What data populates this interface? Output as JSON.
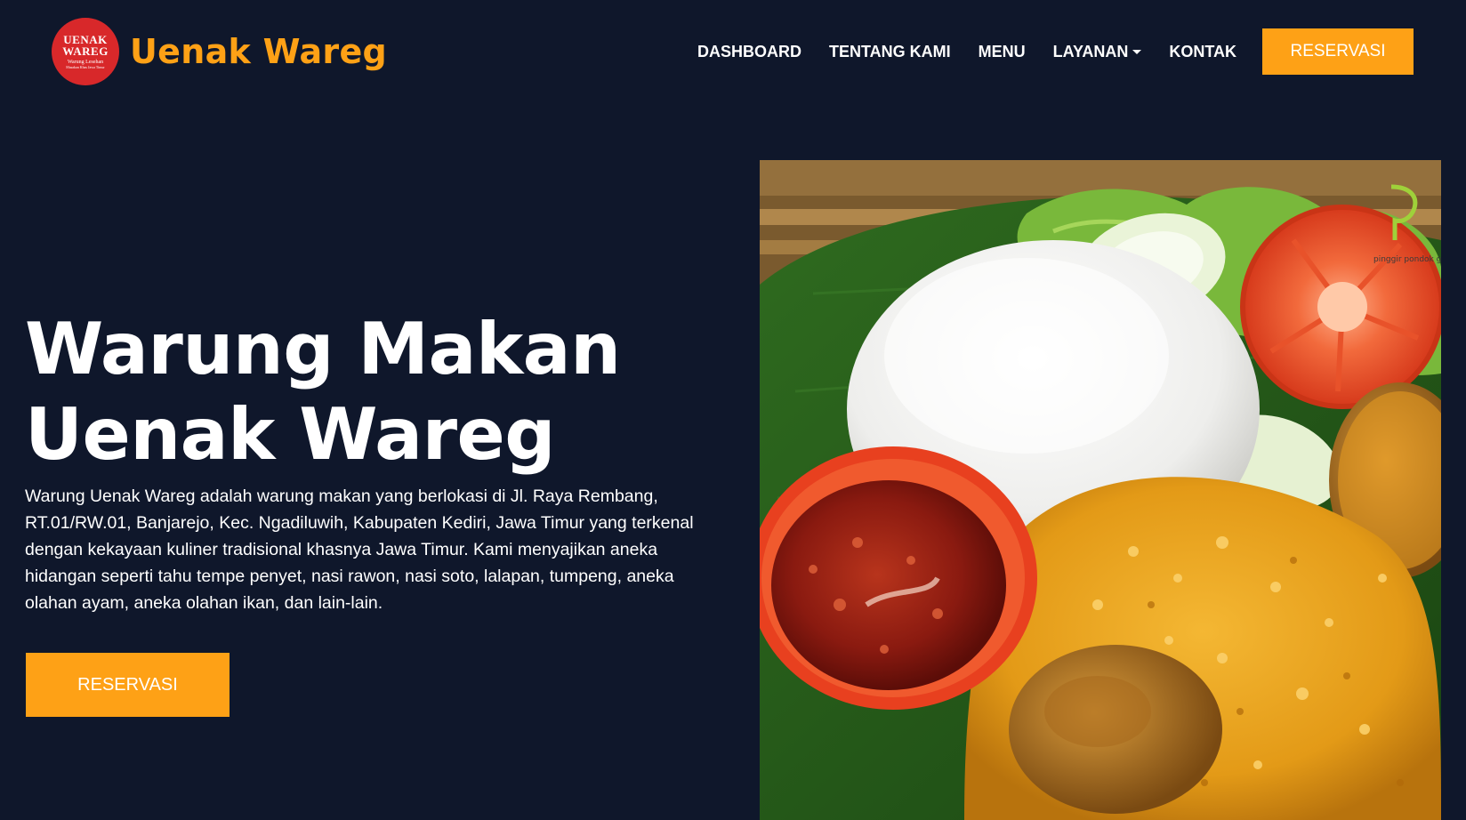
{
  "brand": {
    "logo_line1": "UENAK",
    "logo_line2": "WAREG",
    "logo_line3": "Warung Lesehan",
    "logo_line4": "Masakan Khas Jawa Timur",
    "name": "Uenak Wareg"
  },
  "nav": {
    "items": [
      {
        "label": "DASHBOARD"
      },
      {
        "label": "TENTANG KAMI"
      },
      {
        "label": "MENU"
      },
      {
        "label": "LAYANAN"
      },
      {
        "label": "KONTAK"
      }
    ],
    "reserve_label": "RESERVASI"
  },
  "hero": {
    "title_line1": "Warung Makan",
    "title_line2": "Uenak Wareg",
    "description": "Warung Uenak Wareg adalah warung makan yang berlokasi di Jl. Raya Rembang, RT.01/RW.01, Banjarejo, Kec. Ngadiluwih, Kabupaten Kediri, Jawa Timur yang terkenal dengan kekayaan kuliner tradisional khasnya Jawa Timur. Kami menyajikan aneka hidangan seperti tahu tempe penyet, nasi rawon, nasi soto, lalapan, tumpeng, aneka olahan ayam, aneka olahan ikan, dan lain-lain.",
    "cta_label": "RESERVASI",
    "image_watermark": "pinggir pondok gede"
  },
  "colors": {
    "background": "#0f172b",
    "accent": "#fea116",
    "logo_red": "#d8282a",
    "text": "#ffffff"
  }
}
